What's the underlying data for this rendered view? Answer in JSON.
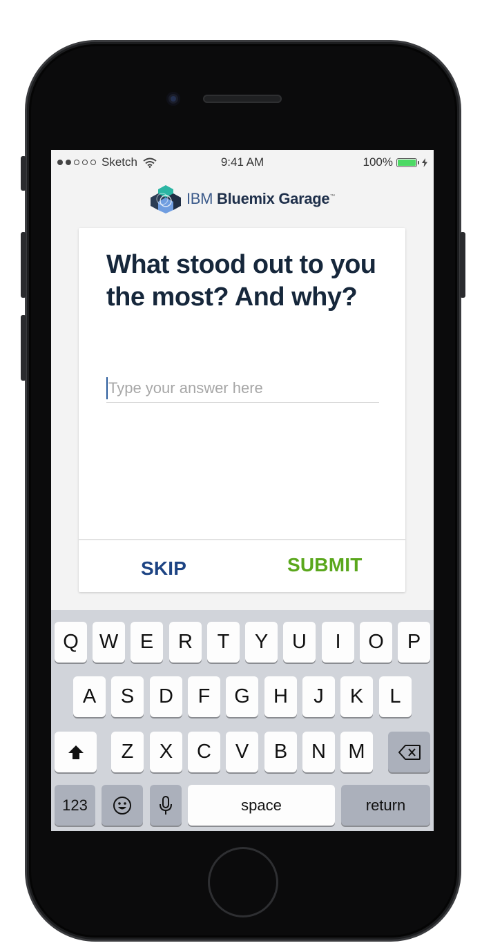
{
  "status_bar": {
    "carrier": "Sketch",
    "time": "9:41 AM",
    "battery_percent": "100%",
    "signal_bars": 2
  },
  "brand": {
    "ibm": "IBM",
    "name": "Bluemix Garage",
    "tm": "™"
  },
  "question": {
    "text": "What stood out to you the most? And why?"
  },
  "answer": {
    "value": "",
    "placeholder": "Type your answer here"
  },
  "actions": {
    "skip_label": "SKIP",
    "submit_label": "SUBMIT"
  },
  "keyboard": {
    "row1": [
      "Q",
      "W",
      "E",
      "R",
      "T",
      "Y",
      "U",
      "I",
      "O",
      "P"
    ],
    "row2": [
      "A",
      "S",
      "D",
      "F",
      "G",
      "H",
      "J",
      "K",
      "L"
    ],
    "row3": [
      "Z",
      "X",
      "C",
      "V",
      "B",
      "N",
      "M"
    ],
    "numbers_label": "123",
    "space_label": "space",
    "return_label": "return"
  },
  "colors": {
    "skip": "#1c4383",
    "submit": "#5aa71c",
    "question": "#16273b",
    "battery": "#4cd964"
  },
  "icons": [
    "wifi-icon",
    "battery-icon",
    "charging-bolt-icon",
    "shift-icon",
    "backspace-icon",
    "emoji-icon",
    "microphone-icon",
    "bluemix-logo-icon"
  ]
}
